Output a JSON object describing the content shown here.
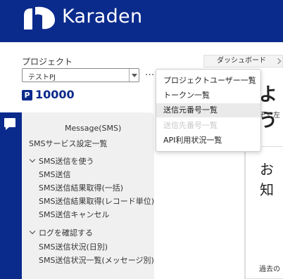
{
  "header": {
    "brand": "Karaden",
    "brand_color": "#0a2a8c",
    "logo_icon": "karaden-logo-icon"
  },
  "project": {
    "label": "プロジェクト",
    "selected": "テストPJ",
    "points_badge": "P",
    "points": "10000"
  },
  "breadcrumb": {
    "current": "ダッシュボード"
  },
  "dropdown": {
    "items": [
      {
        "label": "プロジェクトユーザー一覧",
        "state": "normal"
      },
      {
        "label": "トークン一覧",
        "state": "normal"
      },
      {
        "label": "送信元番号一覧",
        "state": "hover"
      },
      {
        "label": "送信先番号一覧",
        "state": "disabled"
      },
      {
        "label": "API利用状況一覧",
        "state": "normal"
      }
    ]
  },
  "main": {
    "big_heading": "よう",
    "sub_text": "そく左",
    "notice_heading": "お知",
    "past_text": "過去の"
  },
  "sidebar": {
    "title": "Message(SMS)",
    "settings_item": "SMSサービス設定一覧",
    "groups": [
      {
        "label": "SMS送信を使う",
        "items": [
          "SMS送信",
          "SMS送信結果取得(一括)",
          "SMS送信結果取得(レコード単位)",
          "SMS送信キャンセル"
        ]
      },
      {
        "label": "ログを確認する",
        "items": [
          "SMS送信状況(日別)",
          "SMS送信状況一覧(メッセージ別)"
        ]
      }
    ]
  }
}
